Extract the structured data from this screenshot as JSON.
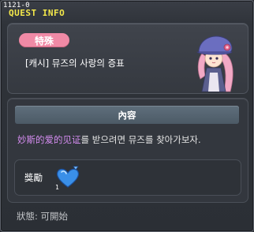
{
  "window": {
    "quest_id": "1121-0",
    "title": "QUEST INFO"
  },
  "quest": {
    "category_badge": "特殊",
    "name": "[캐시] 뮤즈의 사랑의 증표",
    "npc_icon": "npc-portrait-purple-hat-pink-hair"
  },
  "content": {
    "header": "內容",
    "highlight": "妙斯的爱的见证",
    "rest": "를 받으려면 뮤즈를 찾아가보자."
  },
  "reward": {
    "label": "獎勵",
    "item_icon": "blue-heart-icon",
    "item_count": "1"
  },
  "status": {
    "text": "狀態: 可開始"
  },
  "colors": {
    "title": "#f5e94a",
    "badge": "#f08aa6",
    "highlight": "#d58cf0",
    "header": "#55636f"
  }
}
